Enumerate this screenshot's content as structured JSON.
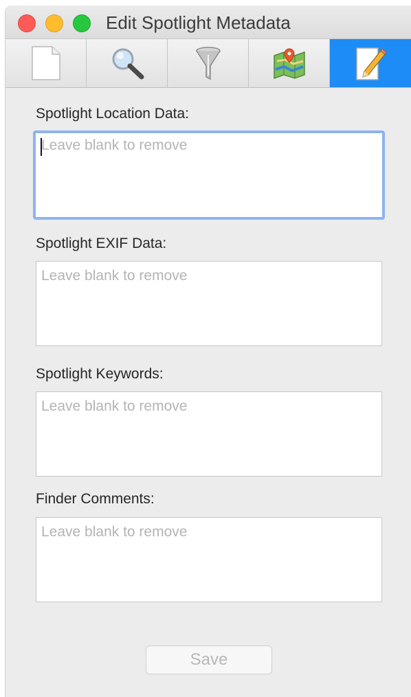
{
  "window": {
    "title": "Edit Spotlight Metadata",
    "controls": [
      "close",
      "minimize",
      "zoom"
    ]
  },
  "toolbar": {
    "tabs": [
      {
        "icon": "document-icon",
        "active": false
      },
      {
        "icon": "magnifier-icon",
        "active": false
      },
      {
        "icon": "funnel-icon",
        "active": false
      },
      {
        "icon": "map-icon",
        "active": false
      },
      {
        "icon": "edit-pencil-icon",
        "active": true
      }
    ],
    "active_color": "#1d8cf6"
  },
  "form": {
    "fields": [
      {
        "label": "Spotlight Location Data:",
        "placeholder": "Leave blank to remove",
        "value": "",
        "focused": true
      },
      {
        "label": "Spotlight EXIF Data:",
        "placeholder": "Leave blank to remove",
        "value": "",
        "focused": false
      },
      {
        "label": "Spotlight Keywords:",
        "placeholder": "Leave blank to remove",
        "value": "",
        "focused": false
      },
      {
        "label": "Finder Comments:",
        "placeholder": "Leave blank to remove",
        "value": "",
        "focused": false
      }
    ],
    "save_label": "Save"
  }
}
